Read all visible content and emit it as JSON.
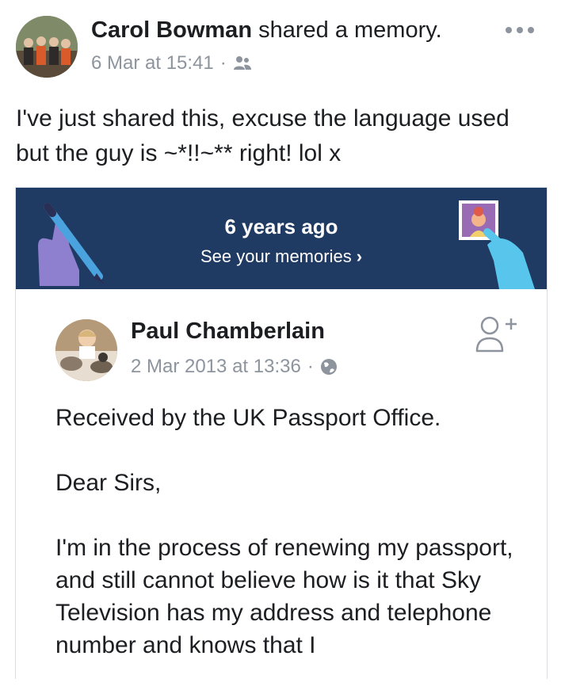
{
  "post": {
    "author": "Carol Bowman",
    "action": "shared a memory.",
    "timestamp": "6 Mar at 15:41",
    "separator": "·",
    "audience_icon": "friends-icon",
    "more_icon": "more-options-icon",
    "text": "I've just shared this, excuse the language used but the guy is ~*!!~** right! lol x"
  },
  "memory_banner": {
    "title": "6 years ago",
    "link": "See your memories",
    "link_chevron": "›",
    "background": "#1f3a63"
  },
  "shared_post": {
    "author": "Paul Chamberlain",
    "timestamp": "2 Mar 2013 at 13:36",
    "separator": "·",
    "audience_icon": "globe-icon",
    "action_icon": "add-friend-icon",
    "paragraphs": [
      "Received by the UK Passport Office.",
      "Dear Sirs,",
      "I'm in the process of renewing my passport, and still cannot believe how is it that Sky Television has my address and telephone number and knows that I"
    ]
  },
  "colors": {
    "text": "#1c1e21",
    "meta": "#8d949e",
    "banner": "#1f3a63"
  }
}
